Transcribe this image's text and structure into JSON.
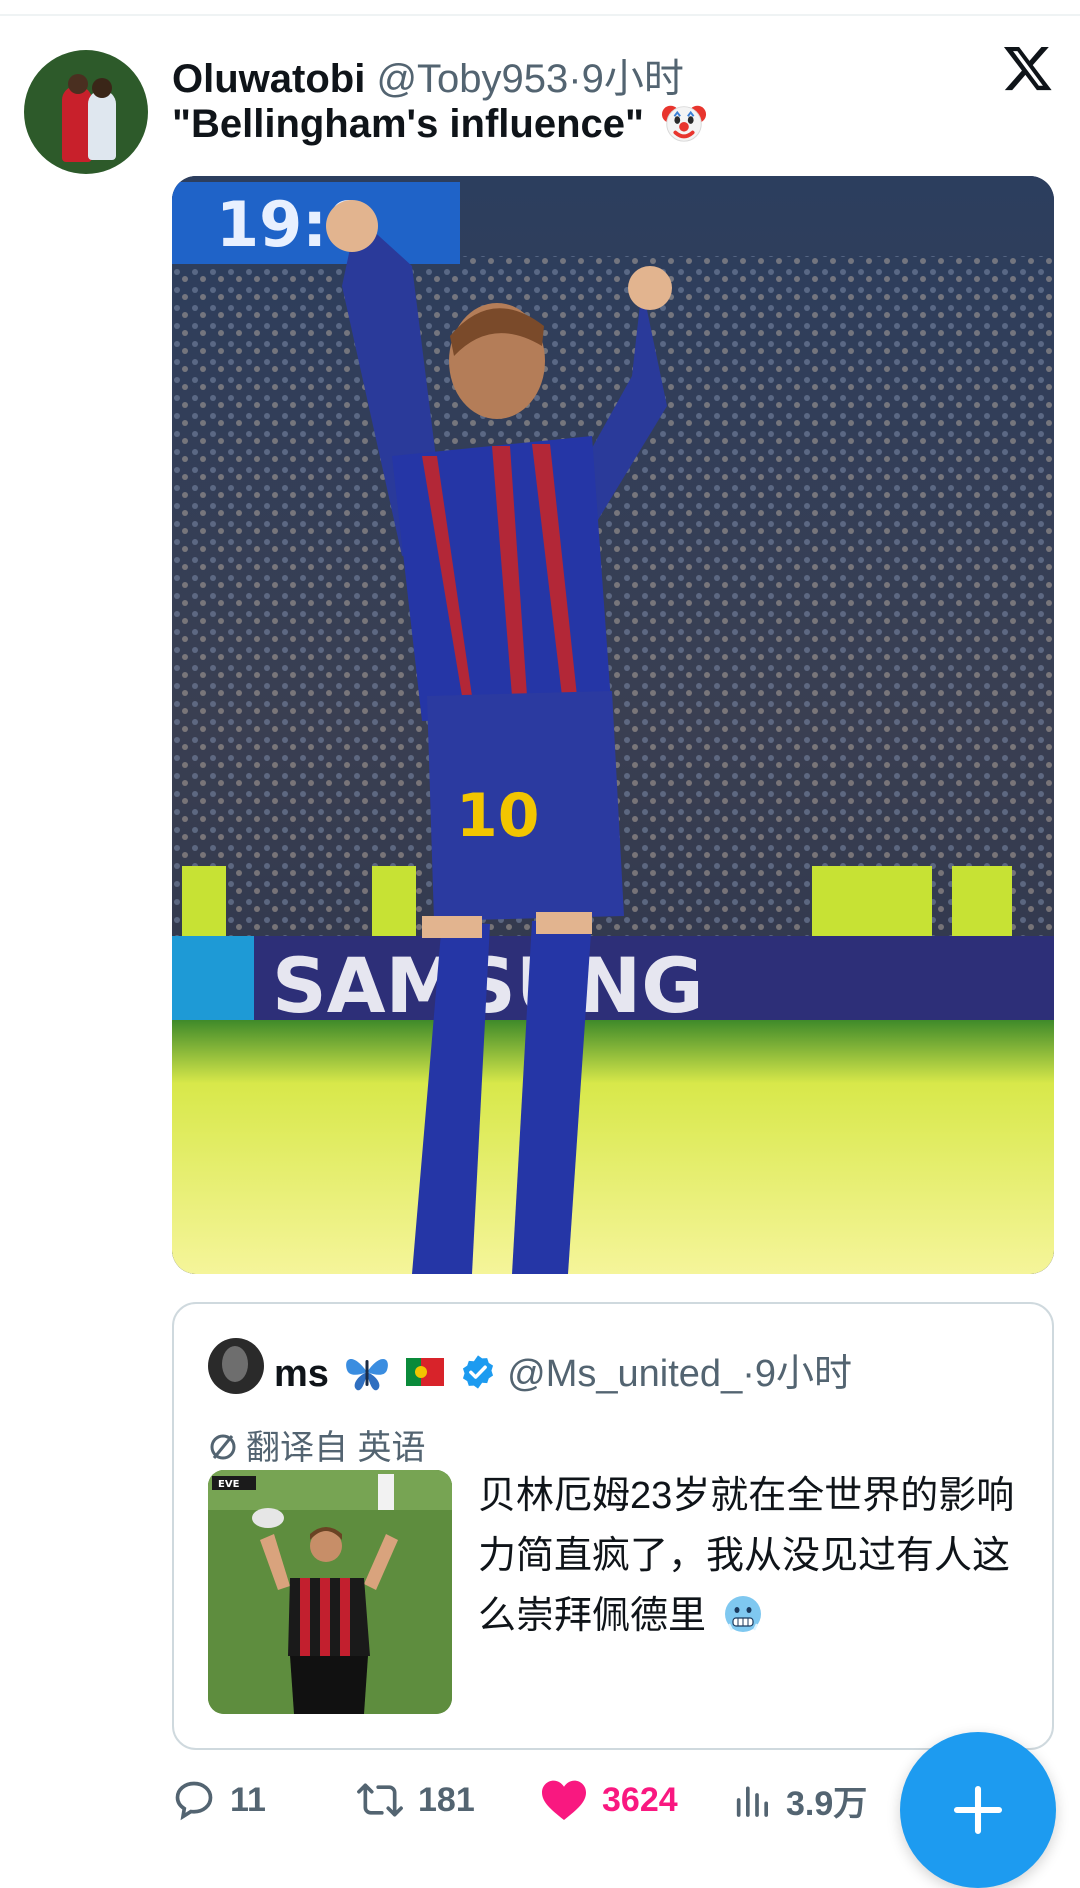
{
  "tweet": {
    "display_name": "Oluwatobi",
    "handle": "@Toby953",
    "separator": "·",
    "time": "9小时",
    "text": "\"Bellingham's influence\"",
    "text_emoji": "clown-face-emoji"
  },
  "brand": {
    "logo": "x-logo-icon"
  },
  "photo": {
    "scoreboard_text": "19:0",
    "shirt_number": "10",
    "board_text": "SAMSUNG"
  },
  "quote": {
    "display_name": "ms",
    "name_emojis": [
      "butterfly-emoji",
      "portugal-flag-emoji"
    ],
    "verified": true,
    "handle": "@Ms_united_",
    "separator": "·",
    "time": "9小时",
    "translated_label": "翻译自 英语",
    "thumbnail_badge": "EVE",
    "text": "贝林厄姆23岁就在全世界的影响力简直疯了，我从没见过有人这么崇拜佩德里",
    "text_emoji": "cold-face-emoji"
  },
  "actions": {
    "replies": "11",
    "retweets": "181",
    "likes": "3624",
    "views": "3.9万"
  },
  "colors": {
    "accent": "#1d9bf0",
    "like": "#f91880",
    "secondary_text": "#536471"
  }
}
